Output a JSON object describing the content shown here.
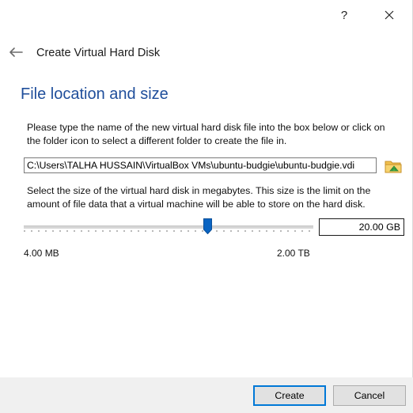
{
  "window": {
    "help_symbol": "?",
    "close_icon": "close-icon"
  },
  "header": {
    "title": "Create Virtual Hard Disk",
    "back_icon": "back-arrow-icon"
  },
  "section": {
    "title": "File location and size"
  },
  "file_location": {
    "description": "Please type the name of the new virtual hard disk file into the box below or click on the folder icon to select a different folder to create the file in.",
    "path_value": "C:\\Users\\TALHA HUSSAIN\\VirtualBox VMs\\ubuntu-budgie\\ubuntu-budgie.vdi",
    "folder_icon": "folder-icon"
  },
  "size": {
    "description": "Select the size of the virtual hard disk in megabytes. This size is the limit on the amount of file data that a virtual machine will be able to store on the hard disk.",
    "slider_fraction": 0.635,
    "value_text": "20.00 GB",
    "min_label": "4.00 MB",
    "max_label": "2.00 TB"
  },
  "footer": {
    "create_label": "Create",
    "cancel_label": "Cancel"
  },
  "colors": {
    "section_title": "#1f4e9b",
    "slider_thumb": "#0a64c2",
    "default_button_border": "#0078d7",
    "folder_yellow": "#f2c14e",
    "folder_green": "#3fae49"
  }
}
